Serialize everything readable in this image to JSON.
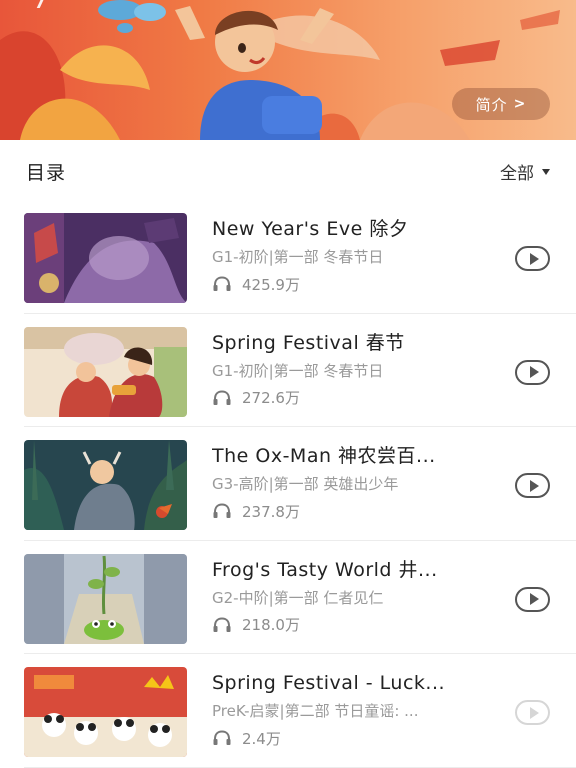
{
  "banner": {
    "intro_label": "简介",
    "intro_chevron": ">"
  },
  "section": {
    "title": "目录",
    "filter_label": "全部"
  },
  "episodes": [
    {
      "title": "New Year's Eve 除夕",
      "subtitle": "G1-初阶|第一部 冬春节日",
      "plays": "425.9万",
      "play_enabled": true
    },
    {
      "title": "Spring Festival 春节",
      "subtitle": "G1-初阶|第一部 冬春节日",
      "plays": "272.6万",
      "play_enabled": true
    },
    {
      "title": "The Ox-Man 神农尝百...",
      "subtitle": "G3-高阶|第一部 英雄出少年",
      "plays": "237.8万",
      "play_enabled": true
    },
    {
      "title": "Frog's Tasty World 井...",
      "subtitle": "G2-中阶|第一部 仁者见仁",
      "plays": "218.0万",
      "play_enabled": true
    },
    {
      "title": "Spring Festival - Luck...",
      "subtitle": "PreK-启蒙|第二部 节日童谣: ...",
      "plays": "2.4万",
      "play_enabled": false
    }
  ],
  "icons": {
    "plays": "headphone-icon",
    "play": "play-icon",
    "filter": "caret-down-icon"
  },
  "colors": {
    "banner_start": "#e8563a",
    "banner_end": "#f8bb8b",
    "text_primary": "#222222",
    "text_secondary": "#9a9a9a",
    "play_active": "#555555",
    "play_disabled": "#d6d6d6"
  }
}
